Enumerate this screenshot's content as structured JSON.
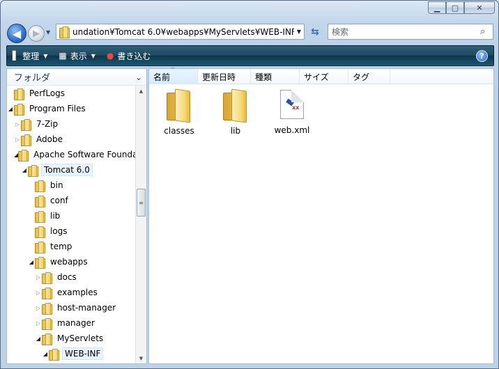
{
  "window": {
    "caption_buttons": {
      "minimize": "▁",
      "maximize": "▢",
      "close": "✕"
    }
  },
  "nav": {
    "back_icon": "◀",
    "forward_icon": "▶",
    "history_icon": "▼"
  },
  "address": {
    "path": "undation¥Tomcat 6.0¥webapps¥MyServlets¥WEB-INF",
    "dropdown_icon": "▼",
    "refresh_icon": "⇆"
  },
  "search": {
    "placeholder": "検索",
    "icon": "⌕"
  },
  "toolbar": {
    "organize_label": "整理",
    "organize_icon": "▌",
    "views_label": "表示",
    "views_icon": "▦",
    "burn_label": "書き込む",
    "burn_icon": "●",
    "dropdown_icon": "▼",
    "help_icon": "?"
  },
  "navpane": {
    "header": "フォルダ",
    "header_chevron": "⌄",
    "tree": [
      {
        "label": "PerfLogs",
        "arrow": ""
      },
      {
        "label": "Program Files",
        "arrow": "◢"
      },
      {
        "label": "7-Zip",
        "arrow": "▷"
      },
      {
        "label": "Adobe",
        "arrow": "▷"
      },
      {
        "label": "Apache Software Founda",
        "arrow": "◢"
      },
      {
        "label": "Tomcat 6.0",
        "arrow": "◢"
      },
      {
        "label": "bin",
        "arrow": ""
      },
      {
        "label": "conf",
        "arrow": ""
      },
      {
        "label": "lib",
        "arrow": ""
      },
      {
        "label": "logs",
        "arrow": ""
      },
      {
        "label": "temp",
        "arrow": ""
      },
      {
        "label": "webapps",
        "arrow": "◢"
      },
      {
        "label": "docs",
        "arrow": "▷"
      },
      {
        "label": "examples",
        "arrow": "▷"
      },
      {
        "label": "host-manager",
        "arrow": "▷"
      },
      {
        "label": "manager",
        "arrow": "▷"
      },
      {
        "label": "MyServlets",
        "arrow": "◢"
      },
      {
        "label": "WEB-INF",
        "arrow": "◢"
      }
    ],
    "scroll": {
      "up": "▲",
      "down": "▼",
      "grip": "≡"
    }
  },
  "content": {
    "columns": [
      "名前",
      "更新日時",
      "種類",
      "サイズ",
      "タグ"
    ],
    "sort_indicator": "^",
    "items": [
      {
        "label": "classes",
        "type": "folder"
      },
      {
        "label": "lib",
        "type": "folder"
      },
      {
        "label": "web.xml",
        "type": "file"
      }
    ],
    "xml_mark": "xx"
  }
}
